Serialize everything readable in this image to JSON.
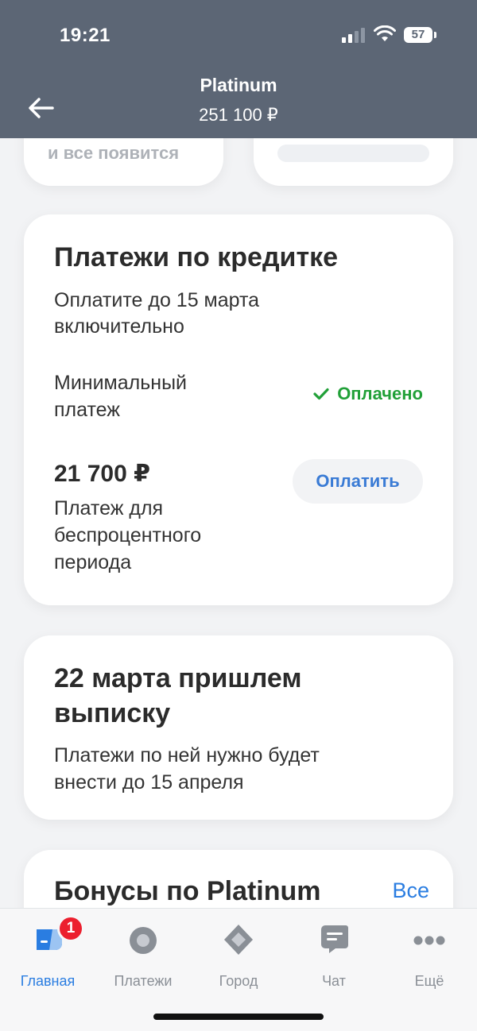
{
  "status_bar": {
    "time": "19:21",
    "battery": "57"
  },
  "header": {
    "title": "Platinum",
    "balance": "251 100 ₽"
  },
  "top_cards": {
    "left_text": "и все появится"
  },
  "payments_card": {
    "title": "Платежи по кредитке",
    "deadline_line1": "Оплатите до 15 марта",
    "deadline_line2": "включительно",
    "min_payment_line1": "Минимальный",
    "min_payment_line2": "платеж",
    "min_payment_status": "Оплачено",
    "amount": "21 700 ₽",
    "amount_desc_line1": "Платеж для",
    "amount_desc_line2": "беспроцентного",
    "amount_desc_line3": "периода",
    "pay_button": "Оплатить"
  },
  "statement_card": {
    "title_line1": "22 марта пришлем",
    "title_line2": "выписку",
    "text_line1": "Платежи по ней нужно будет",
    "text_line2": "внести до 15 апреля"
  },
  "bonus_card": {
    "title": "Бонусы по Platinum",
    "all_link": "Все"
  },
  "tabbar": {
    "tabs": [
      {
        "label": "Главная",
        "icon": "chat-bubble-icon",
        "badge": "1"
      },
      {
        "label": "Платежи",
        "icon": "circle-icon"
      },
      {
        "label": "Город",
        "icon": "diamond-icon"
      },
      {
        "label": "Чат",
        "icon": "message-icon"
      },
      {
        "label": "Ещё",
        "icon": "more-icon"
      }
    ]
  },
  "colors": {
    "header_bg": "#5c6675",
    "accent_blue": "#2a7de1",
    "success_green": "#21a038",
    "badge_red": "#ec1f2e"
  }
}
